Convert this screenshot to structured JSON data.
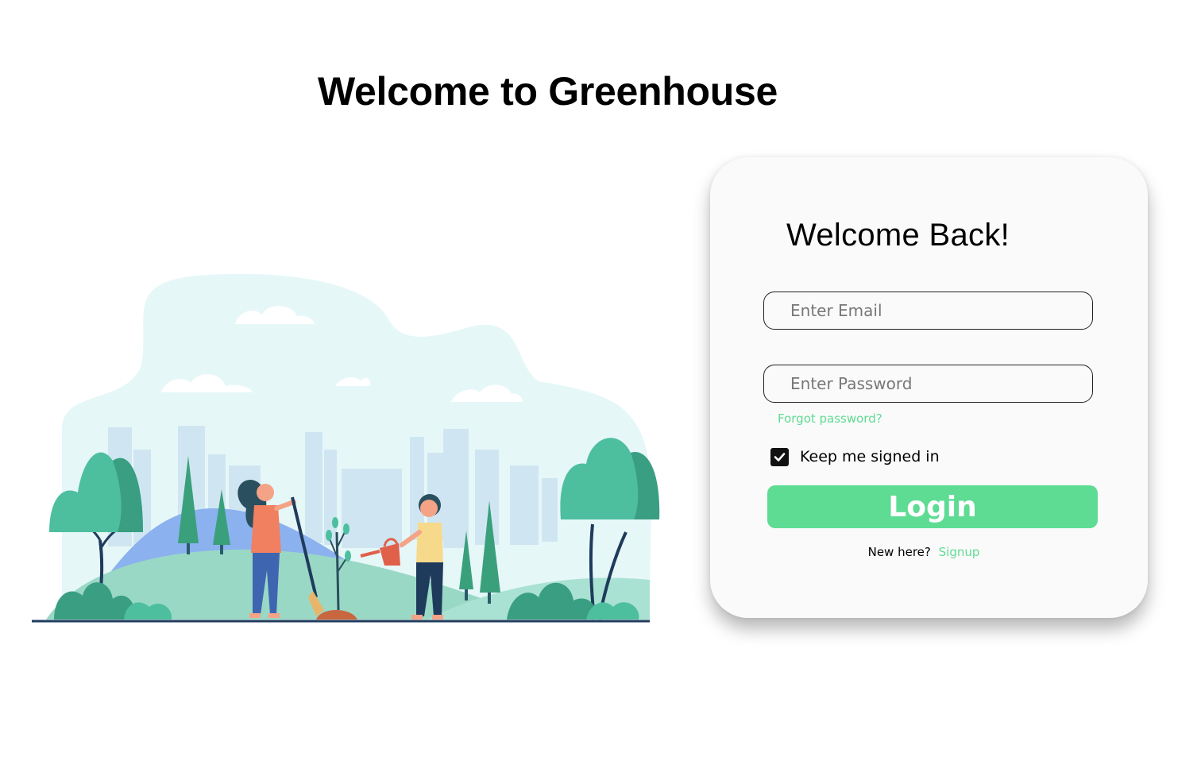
{
  "page": {
    "title": "Welcome to Greenhouse"
  },
  "login": {
    "heading": "Welcome Back!",
    "email_placeholder": "Enter Email",
    "password_placeholder": "Enter Password",
    "forgot_password": "Forgot password?",
    "keep_signed_in_label": "Keep me signed in",
    "keep_signed_in_checked": true,
    "login_button": "Login",
    "signup_prompt": "New here?",
    "signup_link": "Signup"
  },
  "illustration": {
    "subject": "people-planting-trees-illustration"
  },
  "colors": {
    "accent": "#5edc94",
    "card_background": "#fbfafa",
    "text": "#000000",
    "illustration_teal": "#4dbf9f",
    "illustration_sky": "#e6f7f8",
    "illustration_city": "#cfe6f2"
  }
}
